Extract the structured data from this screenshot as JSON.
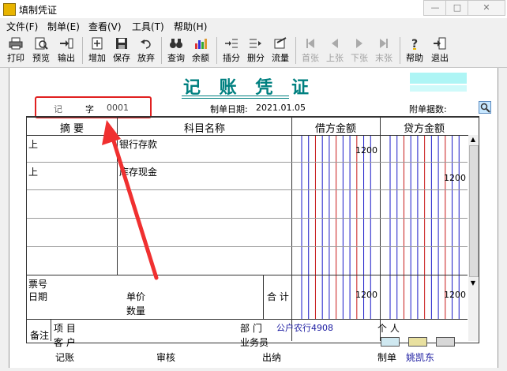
{
  "window": {
    "title": "填制凭证"
  },
  "menu": [
    "文件(F)",
    "制单(E)",
    "查看(V)",
    "工具(T)",
    "帮助(H)"
  ],
  "toolbar": [
    {
      "label": "打印",
      "icon": "printer-icon"
    },
    {
      "label": "预览",
      "icon": "preview-icon"
    },
    {
      "label": "输出",
      "icon": "export-icon"
    },
    {
      "label": "增加",
      "icon": "add-icon"
    },
    {
      "label": "保存",
      "icon": "save-icon"
    },
    {
      "label": "放弃",
      "icon": "undo-icon"
    },
    {
      "label": "查询",
      "icon": "binoculars-icon"
    },
    {
      "label": "余额",
      "icon": "bar-chart-icon"
    },
    {
      "label": "插分",
      "icon": "insert-row-icon"
    },
    {
      "label": "删分",
      "icon": "delete-row-icon"
    },
    {
      "label": "流量",
      "icon": "flow-icon"
    },
    {
      "label": "首张",
      "icon": "first-icon"
    },
    {
      "label": "上张",
      "icon": "prev-icon"
    },
    {
      "label": "下张",
      "icon": "next-icon"
    },
    {
      "label": "末张",
      "icon": "last-icon"
    },
    {
      "label": "帮助",
      "icon": "help-icon"
    },
    {
      "label": "退出",
      "icon": "exit-icon"
    }
  ],
  "voucher": {
    "title": "记 账 凭 证",
    "type_label": "记",
    "zi_label": "字",
    "number": "0001",
    "date_label": "制单日期:",
    "date": "2021.01.05",
    "attach_label": "附单据数:",
    "headers": {
      "summary": "摘 要",
      "account": "科目名称",
      "debit": "借方金额",
      "credit": "贷方金额"
    },
    "rows": [
      {
        "summary": "上",
        "account": "银行存款",
        "debit": "1200",
        "credit": ""
      },
      {
        "summary": "上",
        "account": "库存现金",
        "debit": "",
        "credit": "1200"
      }
    ],
    "footer": {
      "ticket_no": "票号",
      "date": "日期",
      "unit_price": "单价",
      "quantity": "数量",
      "total": "合 计",
      "debit_total": "1200",
      "credit_total": "1200"
    },
    "notes": {
      "label": "备注",
      "project": "项  目",
      "customer": "客  户",
      "dept_label": "部  门",
      "dept_value": "公户农行4908",
      "personal": "个  人",
      "clerk": "业务员"
    },
    "bottom": {
      "bookkeeping": "记账",
      "review": "审核",
      "cashier": "出纳",
      "maker_label": "制单",
      "maker": "姚凯东"
    }
  }
}
